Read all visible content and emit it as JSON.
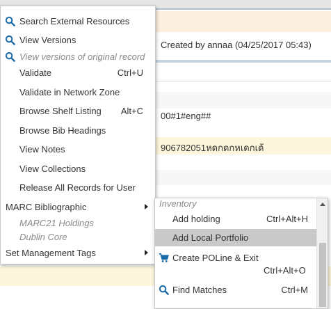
{
  "background": {
    "created_by": "Created by annaa (04/25/2017 05:43)",
    "field_fragment_1": "00#1#eng##",
    "field_fragment_2": "906782051หดกดกหเดกเด้"
  },
  "main_menu": {
    "items": [
      {
        "label": "Search External Resources",
        "shortcut": "",
        "icon": "search-icon"
      },
      {
        "label": "View Versions",
        "shortcut": "",
        "icon": "search-icon"
      },
      {
        "label": "View versions of original record",
        "shortcut": "",
        "icon": "search-icon"
      },
      {
        "label": "Validate",
        "shortcut": "Ctrl+U"
      },
      {
        "label": "Validate in Network Zone",
        "shortcut": ""
      },
      {
        "label": "Browse Shelf Listing",
        "shortcut": "Alt+C"
      },
      {
        "label": "Browse Bib Headings",
        "shortcut": ""
      },
      {
        "label": "View Notes",
        "shortcut": ""
      },
      {
        "label": "View Collections",
        "shortcut": ""
      },
      {
        "label": "Release All Records for User",
        "shortcut": ""
      },
      {
        "label": "MARC Bibliographic",
        "shortcut": ""
      },
      {
        "label": "MARC21 Holdings",
        "shortcut": ""
      },
      {
        "label": "Dublin Core",
        "shortcut": ""
      },
      {
        "label": "Set Management Tags",
        "shortcut": ""
      }
    ]
  },
  "submenu": {
    "header": "Inventory",
    "items": [
      {
        "label": "Add holding",
        "shortcut": "Ctrl+Alt+H"
      },
      {
        "label": "Add Local Portfolio",
        "shortcut": "",
        "active": true
      },
      {
        "label": "Create POLine & Exit",
        "shortcut": "Ctrl+Alt+O",
        "icon": "cart-icon"
      },
      {
        "label": "Find Matches",
        "shortcut": "Ctrl+M",
        "icon": "search-icon"
      }
    ]
  },
  "colors": {
    "icon_blue": "#1a6aa8",
    "active_row": "#c9c9c9",
    "disabled_text": "#8a8a8a"
  }
}
